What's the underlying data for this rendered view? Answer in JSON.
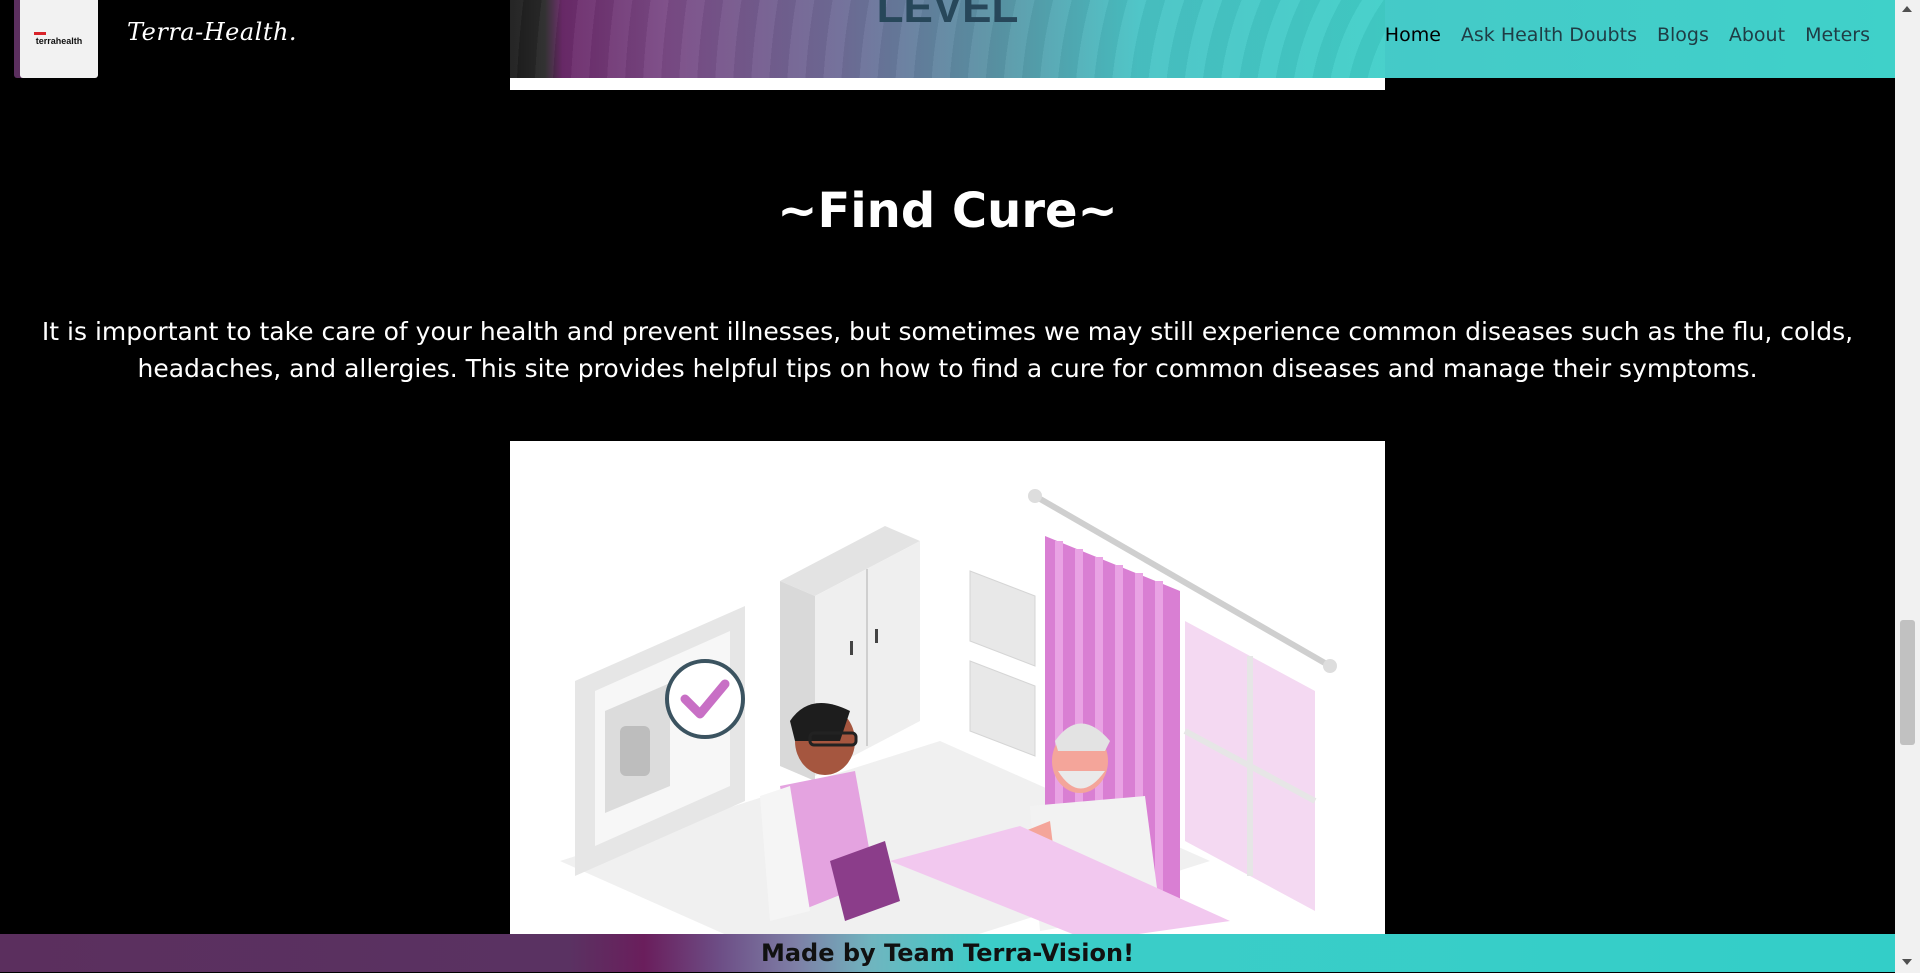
{
  "header": {
    "logo_text": "terrahealth",
    "brand": "Terra-Health.",
    "hero_partial_text": "LEVEL",
    "nav": [
      {
        "label": "Home",
        "active": true
      },
      {
        "label": "Ask Health Doubts",
        "active": false
      },
      {
        "label": "Blogs",
        "active": false
      },
      {
        "label": "About",
        "active": false
      },
      {
        "label": "Meters",
        "active": false
      }
    ]
  },
  "main": {
    "title": "~Find Cure~",
    "paragraph": "It is important to take care of your health and prevent illnesses, but sometimes we may still experience common diseases such as the flu, colds, headaches, and allergies. This site provides helpful tips on how to find a cure for common diseases and manage their symptoms."
  },
  "footer": {
    "text": "Made by Team Terra-Vision!"
  },
  "colors": {
    "accent_teal": "#3fd1c9",
    "accent_purple": "#7c3d7d",
    "illustration_pink": "#d97fd3"
  }
}
